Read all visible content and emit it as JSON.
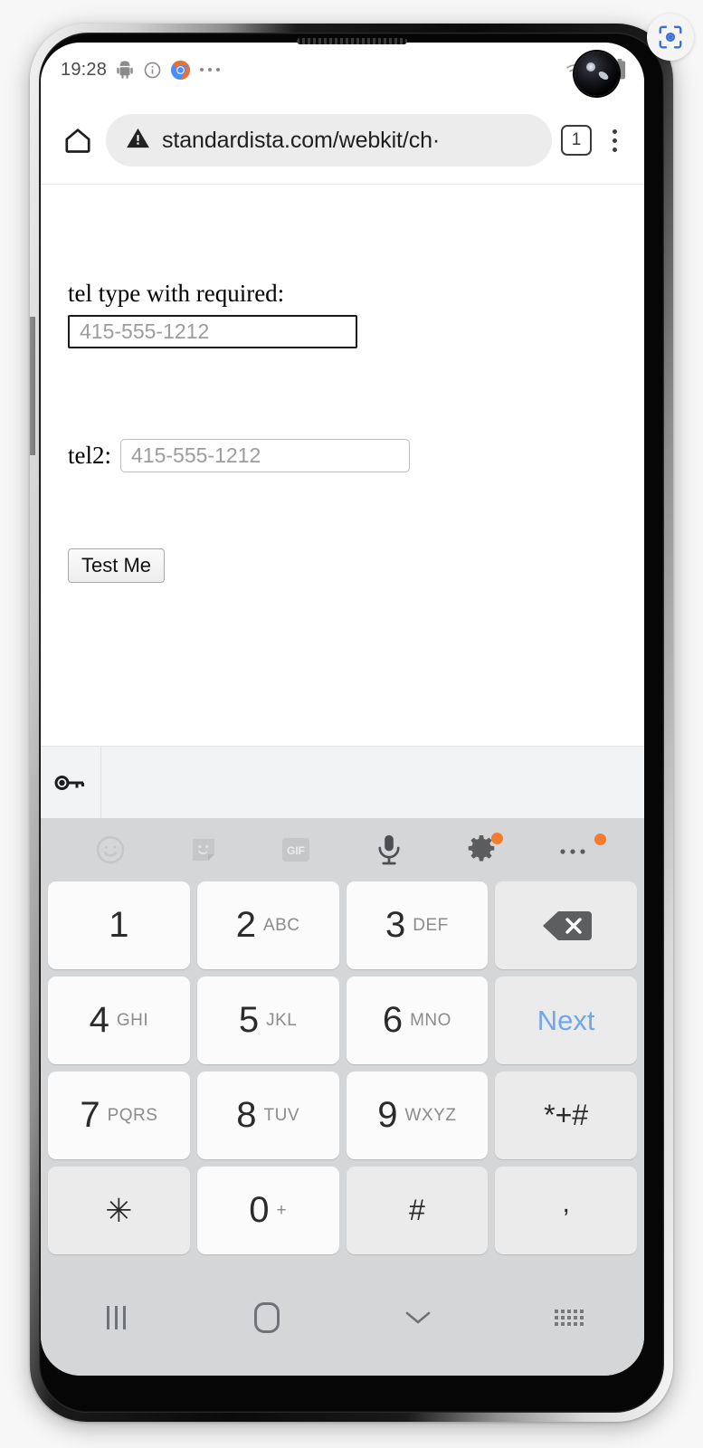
{
  "device": {
    "frame_name": "samsung-galaxy-phone",
    "accent_blue": "#6fa8e8",
    "badge_orange": "#f47c2c"
  },
  "overlay": {
    "lens_icon": "screenshot-scan-icon"
  },
  "status_bar": {
    "clock": "19:28",
    "left_icons": [
      "android-robot-icon",
      "info-circle-icon",
      "chrome-icon",
      "more-notifications-icon"
    ],
    "right_icons": [
      "wifi-icon",
      "signal-bars-icon",
      "battery-icon"
    ]
  },
  "browser": {
    "home_icon": "home-icon",
    "security_icon": "warning-triangle-icon",
    "url": "standardista.com/webkit/ch",
    "url_truncation": "·",
    "tab_count": "1",
    "menu_icon": "overflow-menu-icon"
  },
  "page": {
    "tel1_label": "tel type with required:",
    "tel1_placeholder": "415-555-1212",
    "tel1_value": "",
    "tel2_label": "tel2:",
    "tel2_placeholder": "415-555-1212",
    "tel2_value": "",
    "submit_label": "Test Me"
  },
  "autofill_bar": {
    "key_icon": "password-key-icon"
  },
  "keyboard": {
    "toolbar": [
      {
        "name": "emoji-icon",
        "dimmed": true,
        "badge": false
      },
      {
        "name": "sticker-icon",
        "dimmed": true,
        "badge": false
      },
      {
        "name": "gif-icon",
        "dimmed": true,
        "badge": false,
        "label": "GIF"
      },
      {
        "name": "microphone-icon",
        "dimmed": false,
        "badge": false
      },
      {
        "name": "settings-gear-icon",
        "dimmed": false,
        "badge": true
      },
      {
        "name": "keyboard-more-icon",
        "dimmed": false,
        "badge": true
      }
    ],
    "rows": [
      [
        {
          "type": "digit",
          "digit": "1",
          "sub": "",
          "style": "white"
        },
        {
          "type": "digit",
          "digit": "2",
          "sub": "ABC",
          "style": "white"
        },
        {
          "type": "digit",
          "digit": "3",
          "sub": "DEF",
          "style": "white"
        },
        {
          "type": "backspace",
          "label": "",
          "style": "gray"
        }
      ],
      [
        {
          "type": "digit",
          "digit": "4",
          "sub": "GHI",
          "style": "white"
        },
        {
          "type": "digit",
          "digit": "5",
          "sub": "JKL",
          "style": "white"
        },
        {
          "type": "digit",
          "digit": "6",
          "sub": "MNO",
          "style": "white"
        },
        {
          "type": "action",
          "label": "Next",
          "style": "gray"
        }
      ],
      [
        {
          "type": "digit",
          "digit": "7",
          "sub": "PQRS",
          "style": "white"
        },
        {
          "type": "digit",
          "digit": "8",
          "sub": "TUV",
          "style": "white"
        },
        {
          "type": "digit",
          "digit": "9",
          "sub": "WXYZ",
          "style": "white"
        },
        {
          "type": "symbol",
          "label": "*+#",
          "style": "gray"
        }
      ],
      [
        {
          "type": "symbol",
          "label": "✳",
          "style": "gray"
        },
        {
          "type": "digit",
          "digit": "0",
          "sub": "+",
          "style": "white"
        },
        {
          "type": "symbol",
          "label": "#",
          "style": "gray"
        },
        {
          "type": "comma",
          "label": ",",
          "style": "gray"
        }
      ]
    ]
  },
  "nav_bar": {
    "buttons": [
      "recents-icon",
      "home-icon",
      "hide-keyboard-icon",
      "keyboard-switch-icon"
    ]
  }
}
